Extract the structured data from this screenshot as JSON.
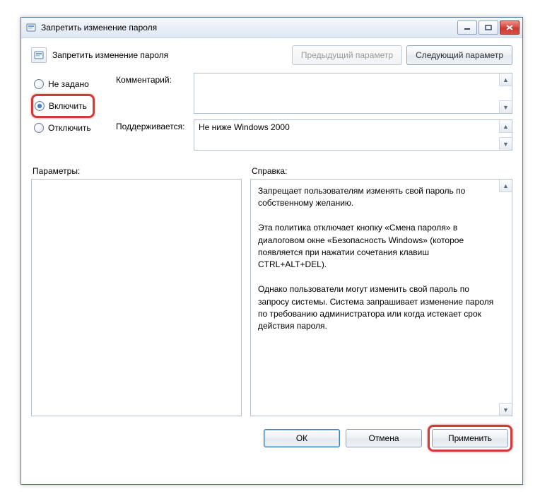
{
  "titlebar": {
    "title": "Запретить изменение пароля"
  },
  "header": {
    "policy_title": "Запретить изменение пароля",
    "prev_button": "Предыдущий параметр",
    "next_button": "Следующий параметр"
  },
  "radios": {
    "not_configured": "Не задано",
    "enabled": "Включить",
    "disabled": "Отключить"
  },
  "fields": {
    "comment_label": "Комментарий:",
    "comment_value": "",
    "supported_label": "Поддерживается:",
    "supported_value": "Не ниже Windows 2000"
  },
  "lower": {
    "params_label": "Параметры:",
    "help_label": "Справка:"
  },
  "help_text": "Запрещает пользователям изменять свой пароль по собственному желанию.\n\nЭта политика отключает кнопку «Смена пароля» в диалоговом окне «Безопасность Windows» (которое появляется при нажатии сочетания клавиш CTRL+ALT+DEL).\n\nОднако пользователи могут изменить свой пароль по запросу системы. Система запрашивает изменение пароля по требованию администратора или когда истекает срок действия пароля.",
  "buttons": {
    "ok": "ОК",
    "cancel": "Отмена",
    "apply": "Применить"
  }
}
